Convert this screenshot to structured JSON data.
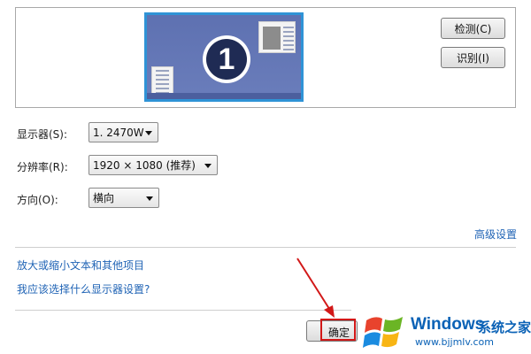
{
  "preview": {
    "display_number": "1"
  },
  "buttons": {
    "detect": "检测(C)",
    "identify": "识别(I)",
    "ok": "确定"
  },
  "settings": {
    "display_label": "显示器(S):",
    "display_value": "1. 2470W",
    "resolution_label": "分辨率(R):",
    "resolution_value": "1920 × 1080 (推荐)",
    "orientation_label": "方向(O):",
    "orientation_value": "横向"
  },
  "links": {
    "advanced": "高级设置",
    "text_size": "放大或缩小文本和其他项目",
    "which_settings": "我应该选择什么显示器设置?"
  },
  "watermark": {
    "brand": "Windows",
    "brand_suffix": "系统之家",
    "url": "www.bjjmlv.com"
  },
  "colors": {
    "link": "#1f63b5",
    "annotation": "#d21818",
    "monitor_frame": "#2f93d6",
    "desktop": "#5e71b1"
  }
}
